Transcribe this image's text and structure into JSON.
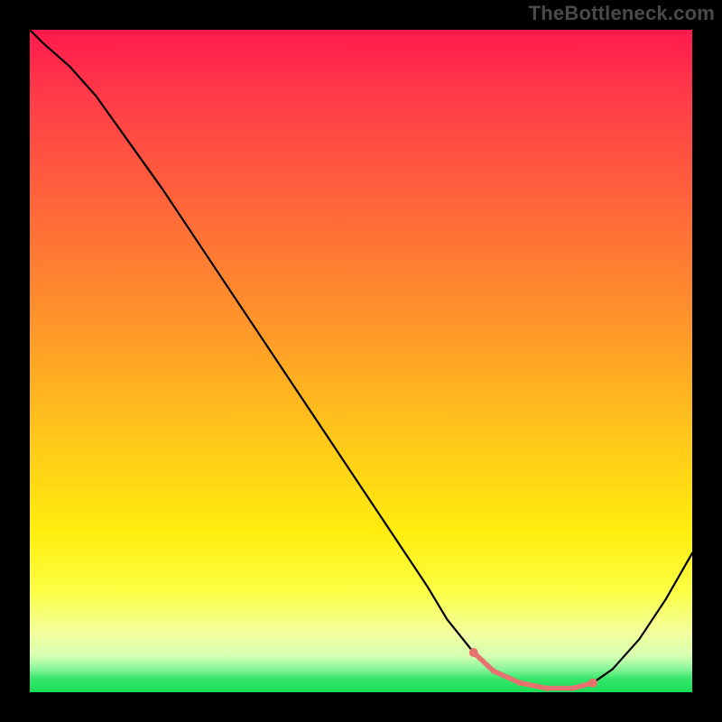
{
  "watermark": "TheBottleneck.com",
  "chart_data": {
    "type": "line",
    "title": "",
    "xlabel": "",
    "ylabel": "",
    "xlim": [
      0,
      100
    ],
    "ylim": [
      0,
      100
    ],
    "grid": false,
    "legend": false,
    "note": "Axes are unlabeled; x and y normalized 0–100 left→right and bottom→top. Curve reads as bottleneck mismatch (high=red=bad, low=green=good). Values estimated from pixel positions.",
    "series": [
      {
        "name": "bottleneck-curve",
        "x": [
          0,
          2,
          6,
          10,
          15,
          20,
          25,
          30,
          35,
          40,
          45,
          50,
          55,
          60,
          63,
          67,
          70,
          74,
          78,
          82,
          85,
          88,
          92,
          96,
          100
        ],
        "y": [
          100,
          98,
          94.5,
          90,
          83,
          76,
          68.5,
          61,
          53.5,
          46,
          38.5,
          31,
          23.5,
          16,
          11,
          6,
          3.2,
          1.4,
          0.6,
          0.6,
          1.4,
          3.5,
          8,
          14,
          21
        ]
      },
      {
        "name": "optimal-range-marker",
        "x": [
          67,
          70,
          74,
          78,
          82,
          85
        ],
        "y": [
          6,
          3.2,
          1.4,
          0.6,
          0.6,
          1.4
        ]
      }
    ],
    "background_gradient": {
      "orientation": "vertical",
      "stops": [
        {
          "pos": 0.0,
          "color": "#ff1a4d"
        },
        {
          "pos": 0.5,
          "color": "#ffad22"
        },
        {
          "pos": 0.8,
          "color": "#fff419"
        },
        {
          "pos": 0.95,
          "color": "#c8ffad"
        },
        {
          "pos": 1.0,
          "color": "#19df57"
        }
      ]
    }
  }
}
